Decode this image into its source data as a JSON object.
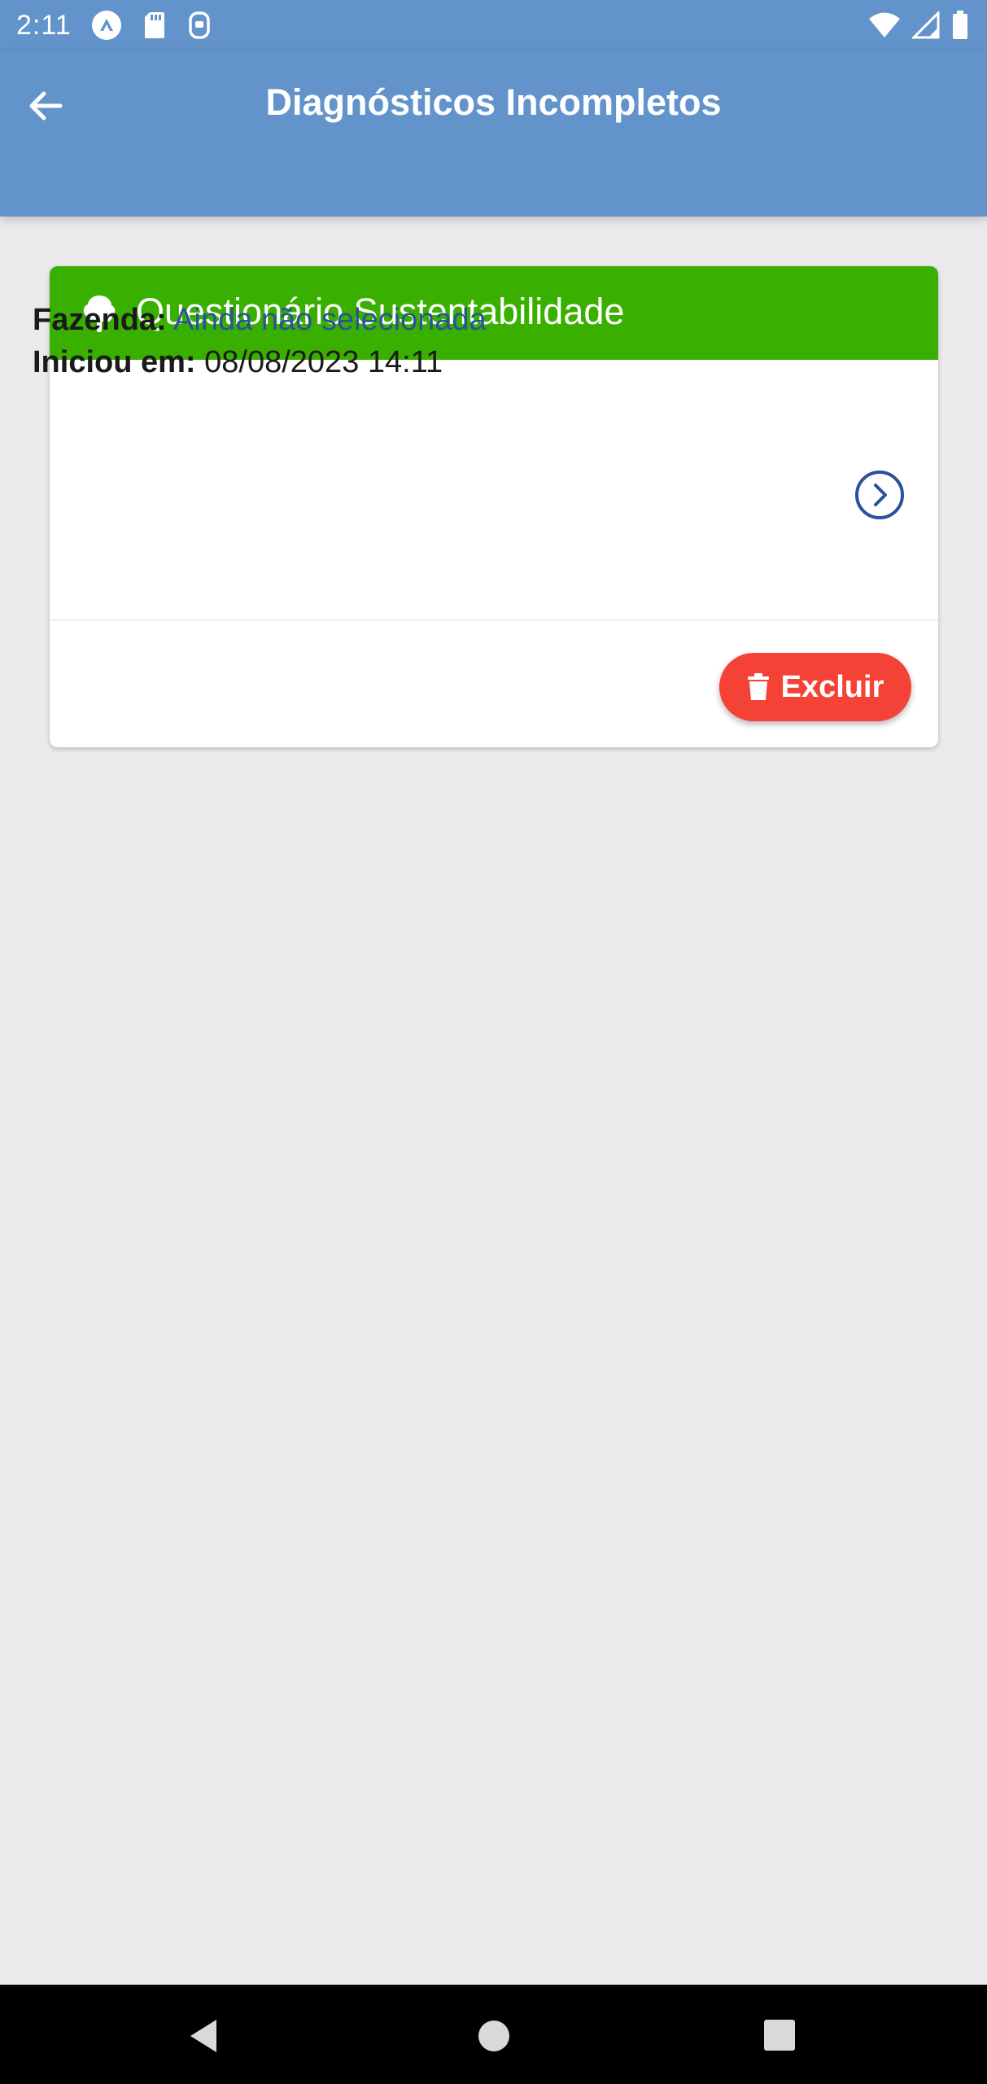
{
  "status_bar": {
    "time": "2:11",
    "left_icons": [
      "app-notification-icon",
      "sd-card-icon",
      "media-icon"
    ],
    "right_icons": [
      "wifi-icon",
      "signal-icon",
      "battery-icon"
    ]
  },
  "app_bar": {
    "title": "Diagnósticos Incompletos",
    "background": "#6294CB"
  },
  "card": {
    "header_title": "Questionário Sustentabilidade",
    "header_color": "#39B000",
    "farm_label": "Fazenda:",
    "farm_value": "Ainda não selecionada",
    "started_label": "Iniciou em:",
    "started_value": "08/08/2023 14:11",
    "delete_label": "Excluir",
    "delete_color": "#F44336",
    "link_color": "#2A5399"
  },
  "nav_bar": {
    "icons": [
      "nav-back-icon",
      "nav-home-icon",
      "nav-recents-icon"
    ]
  }
}
